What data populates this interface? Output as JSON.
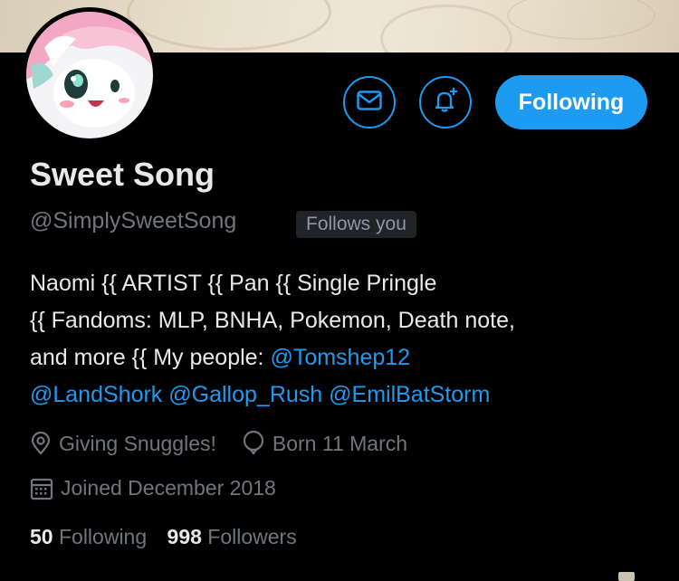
{
  "profile": {
    "name": "Sweet Song",
    "handle": "@SimplySweetSong",
    "follows_you": "Follows you",
    "bio": {
      "line1": "Naomi {{ ARTIST {{ Pan {{ Single Pringle",
      "line2": "{{ Fandoms: MLP, BNHA, Pokemon, Death note,",
      "line3_text": "and more {{ My people: ",
      "mention1": "@Tomshep12",
      "mention2": "@LandShork",
      "mention3": "@Gallop_Rush",
      "mention4": "@EmilBatStorm"
    },
    "location": "Giving Snuggles!",
    "birthday": "Born 11 March",
    "joined": "Joined December 2018",
    "following_count": "50",
    "following_label": "Following",
    "followers_count": "998",
    "followers_label": "Followers"
  },
  "actions": {
    "message_icon": "envelope-icon",
    "notify_icon": "bell-plus-icon",
    "follow_button": "Following"
  },
  "colors": {
    "accent": "#1d9bf0",
    "background": "#000000",
    "text": "#e7e9ea",
    "muted": "#71767b"
  }
}
